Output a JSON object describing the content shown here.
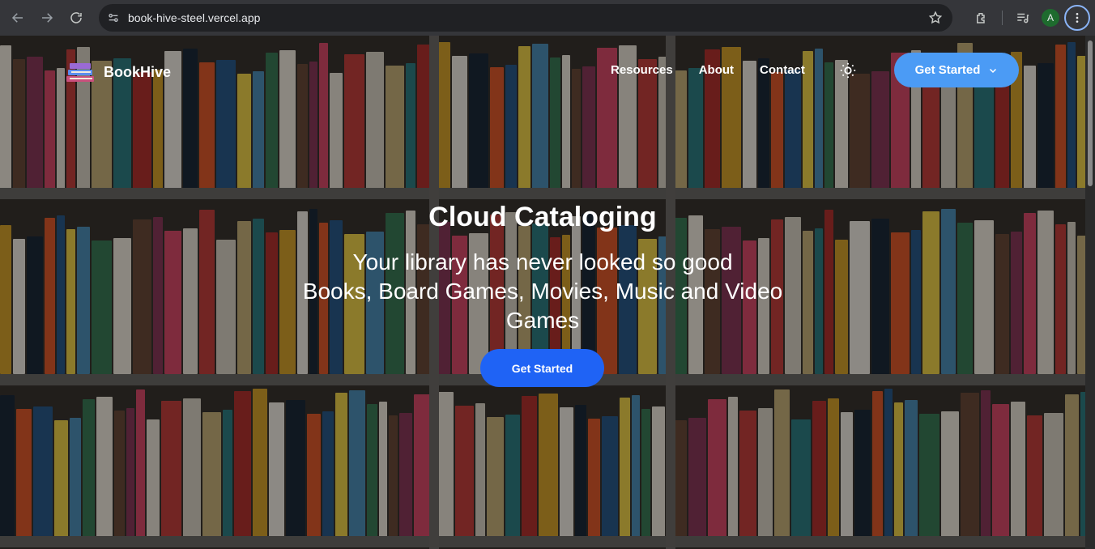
{
  "browser": {
    "url": "book-hive-steel.vercel.app",
    "profile_initial": "A"
  },
  "nav": {
    "brand": "BookHive",
    "links": [
      "Resources",
      "About",
      "Contact"
    ],
    "cta": "Get Started"
  },
  "hero": {
    "title": "Cloud Cataloging",
    "subtitle_line1": "Your library has never looked so good",
    "subtitle_line2": "Books, Board Games, Movies, Music and Video Games",
    "cta": "Get Started"
  },
  "colors": {
    "nav_cta": "#4b9bf5",
    "hero_cta": "#1f63f5"
  }
}
